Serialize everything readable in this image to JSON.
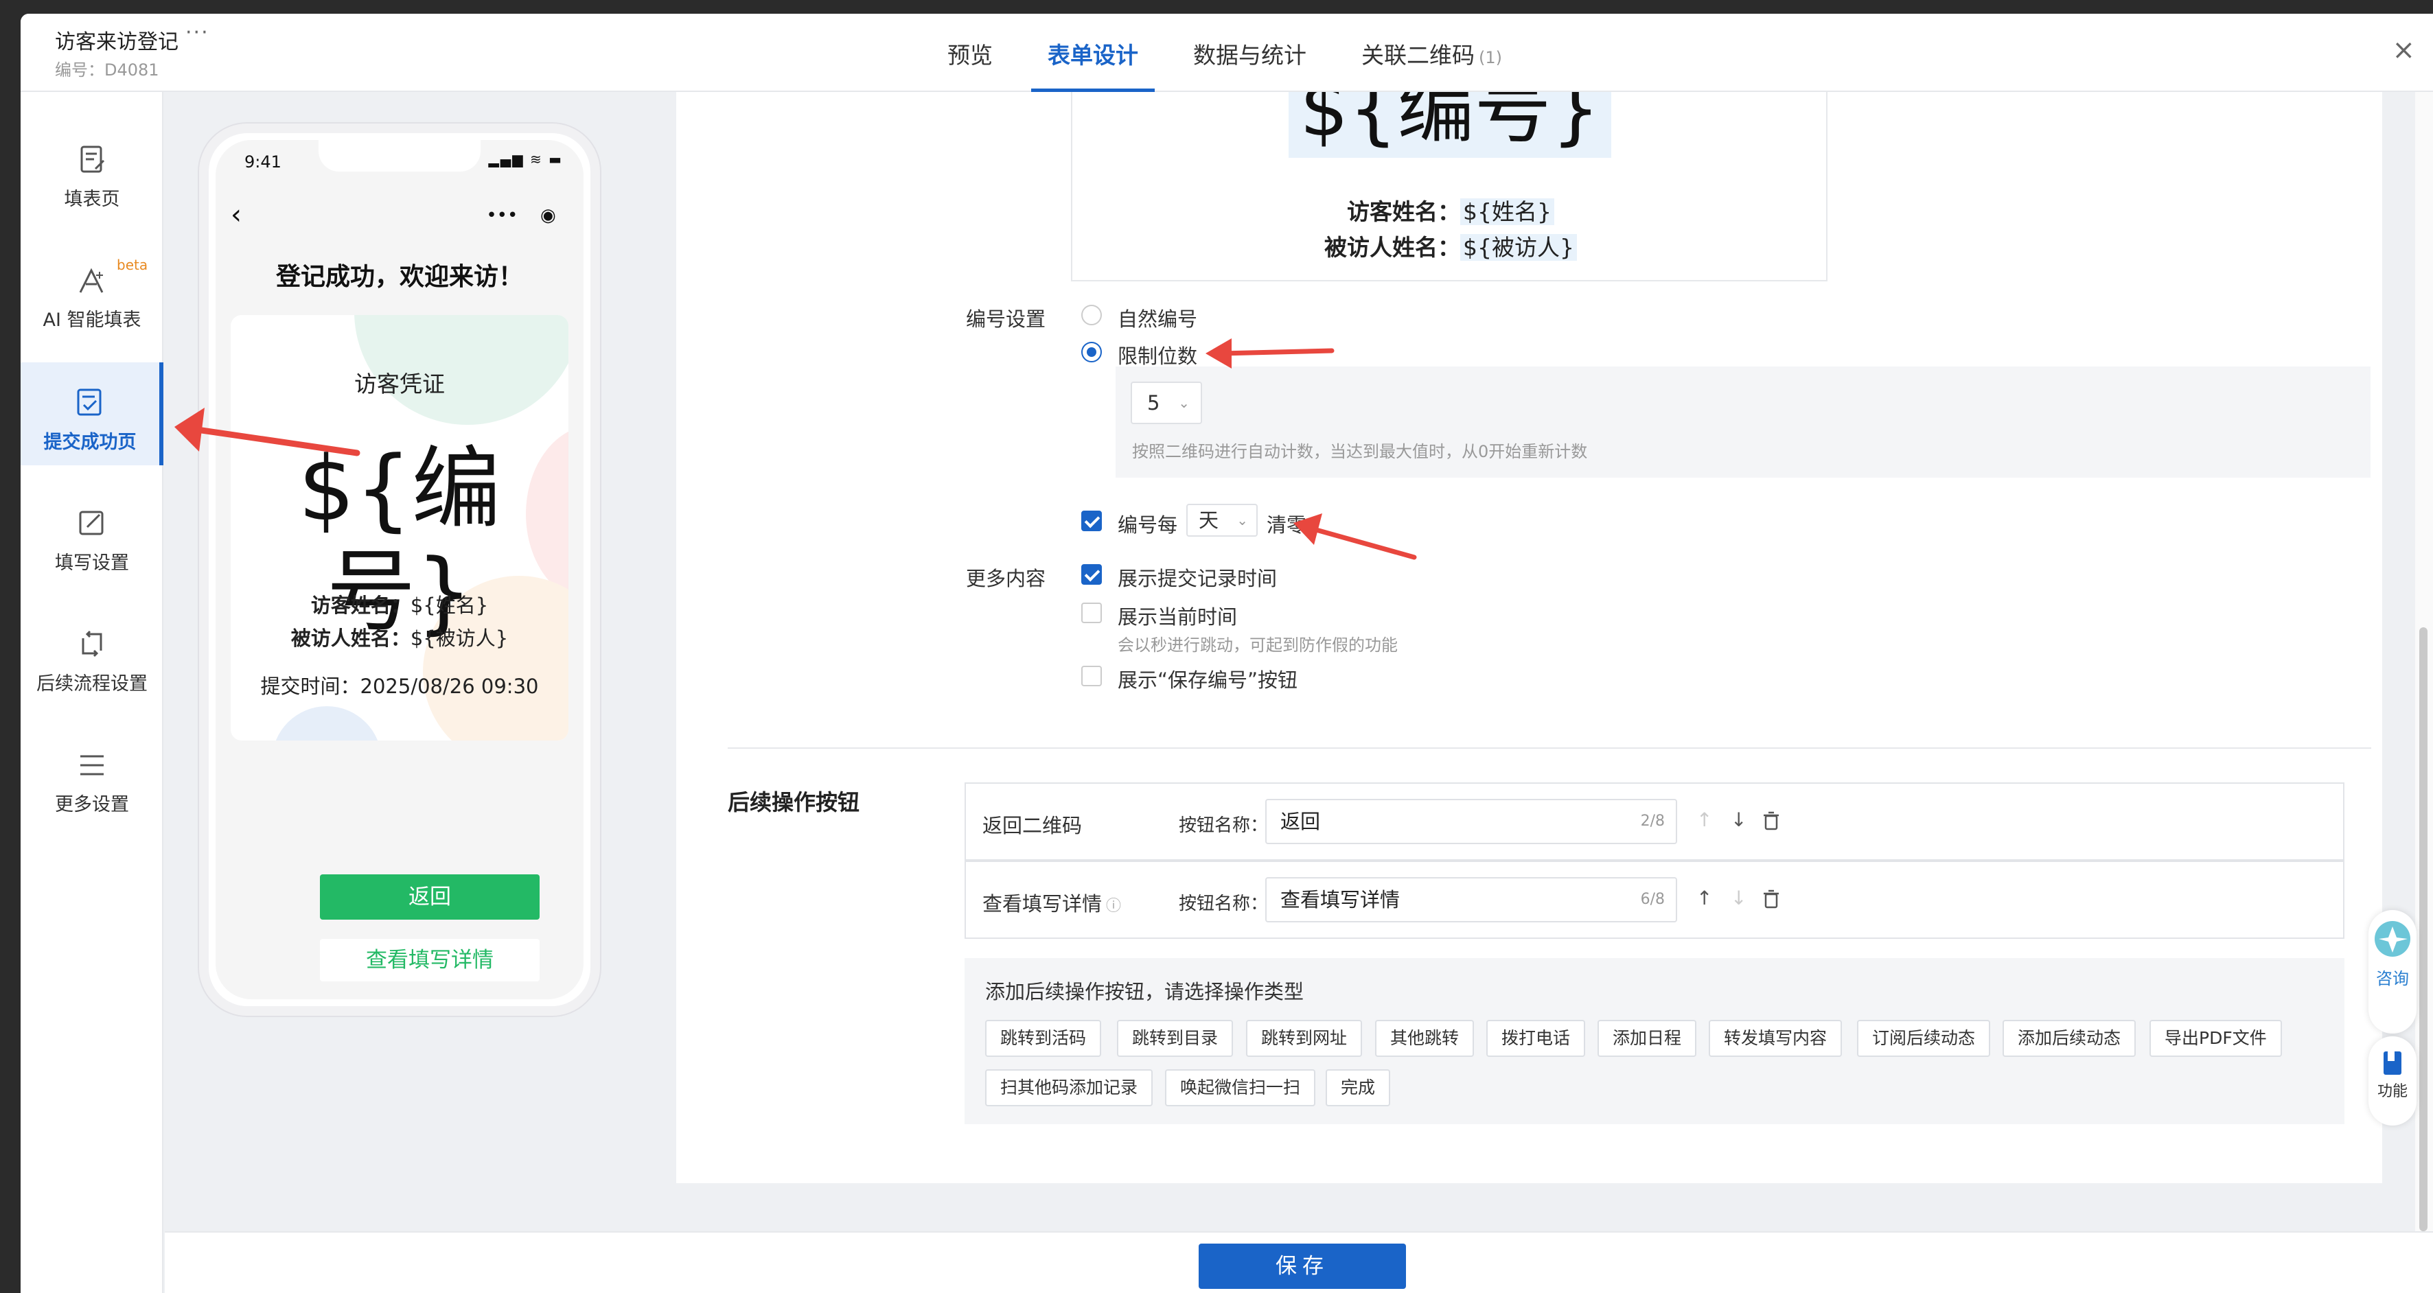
{
  "header": {
    "title": "访客来访登记",
    "more": "···",
    "code": "编号：D4081",
    "tabs": [
      {
        "label": "预览"
      },
      {
        "label": "表单设计"
      },
      {
        "label": "数据与统计"
      },
      {
        "label": "关联二维码",
        "count": "(1)"
      }
    ],
    "close": "×"
  },
  "sidebar": {
    "items": [
      {
        "label": "填表页",
        "icon": "form-icon"
      },
      {
        "label": "AI 智能填表",
        "icon": "ai-icon",
        "badge": "beta"
      },
      {
        "label": "提交成功页",
        "icon": "success-page-icon"
      },
      {
        "label": "填写设置",
        "icon": "edit-icon"
      },
      {
        "label": "后续流程设置",
        "icon": "flow-icon"
      },
      {
        "label": "更多设置",
        "icon": "menu-icon"
      }
    ]
  },
  "phone": {
    "time": "9:41",
    "status": "▂▄▆ ≋ ▬",
    "back": "‹",
    "ops": "•••",
    "target": "◉",
    "heading": "登记成功，欢迎来访！",
    "card": {
      "title": "访客凭证",
      "number": "${编号}",
      "visitor_label": "访客姓名：",
      "visitor_value": "${姓名}",
      "host_label": "被访人姓名：",
      "host_value": "${被访人}",
      "time_label": "提交时间：",
      "time_value": "2025/08/26 09:30"
    },
    "btn_back": "返回",
    "btn_detail": "查看填写详情"
  },
  "preview": {
    "number": "${编号}",
    "visitor_label": "访客姓名：",
    "visitor_value": "${姓名}",
    "host_label": "被访人姓名：",
    "host_value": "${被访人}"
  },
  "numbering": {
    "label": "编号设置",
    "option_natural": "自然编号",
    "option_limit": "限制位数",
    "digits": "5",
    "digits_hint": "按照二维码进行自动计数，当达到最大值时，从0开始重新计数",
    "reset_prefix": "编号每",
    "reset_unit": "天",
    "reset_suffix": "清零"
  },
  "more": {
    "label": "更多内容",
    "show_submit_time": "展示提交记录时间",
    "show_current_time": "展示当前时间",
    "current_time_hint": "会以秒进行跳动，可起到防作假的功能",
    "show_save_button": "展示“保存编号”按钮"
  },
  "followup": {
    "title": "后续操作按钮",
    "name_label": "按钮名称：",
    "rows": [
      {
        "label": "返回二维码",
        "value": "返回",
        "count": "2/8"
      },
      {
        "label": "查看填写详情",
        "value": "查看填写详情",
        "count": "6/8"
      }
    ],
    "add_title": "添加后续操作按钮，请选择操作类型",
    "tags": [
      "跳转到活码",
      "跳转到目录",
      "跳转到网址",
      "其他跳转",
      "拨打电话",
      "添加日程",
      "转发填写内容",
      "订阅后续动态",
      "添加后续动态",
      "导出PDF文件",
      "扫其他码添加记录",
      "唤起微信扫一扫",
      "完成"
    ]
  },
  "footer": {
    "save": "保存"
  },
  "float": {
    "consult": "咨询",
    "function": "功能"
  },
  "colors": {
    "accent": "#1a64c8",
    "green": "#23b965",
    "annotation_arrow": "#e8473e"
  }
}
